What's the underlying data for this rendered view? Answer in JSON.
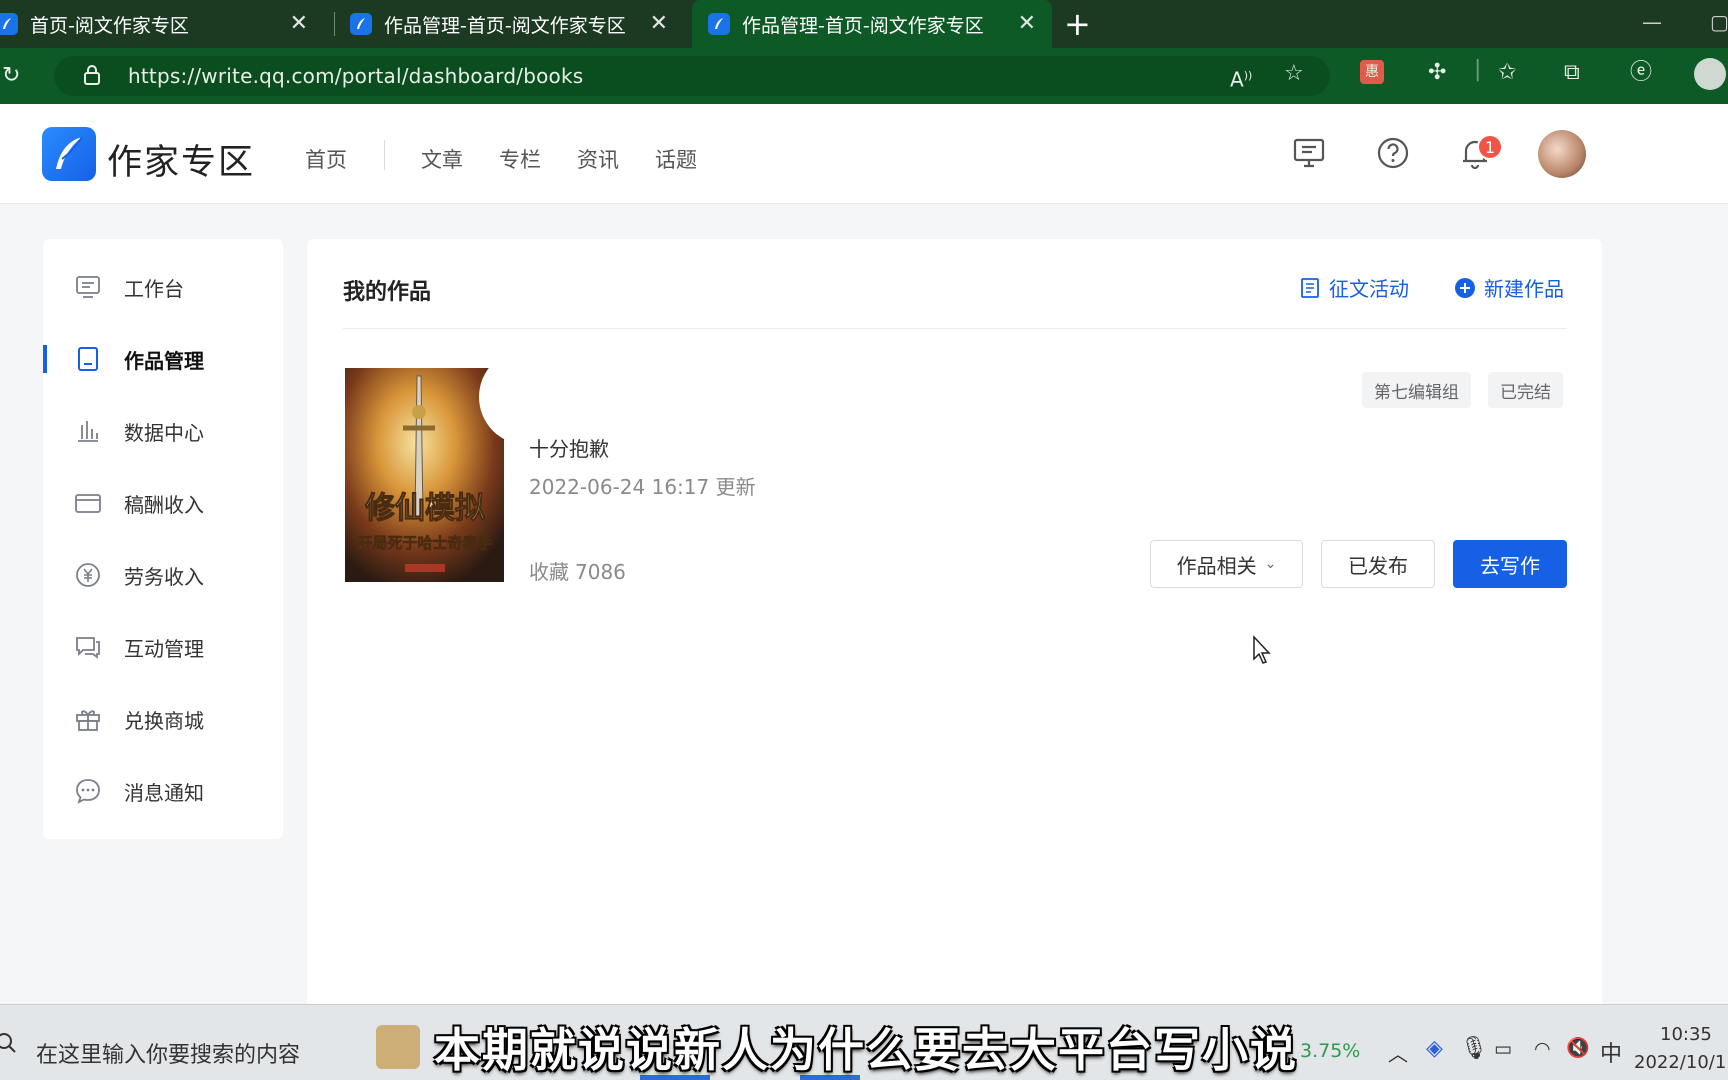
{
  "browser": {
    "tabs": [
      {
        "title": "首页-阅文作家专区",
        "active": false
      },
      {
        "title": "作品管理-首页-阅文作家专区",
        "active": false
      },
      {
        "title": "作品管理-首页-阅文作家专区",
        "active": true
      }
    ],
    "url": "https://write.qq.com/portal/dashboard/books"
  },
  "header": {
    "logo_text": "作家专区",
    "nav": [
      "首页",
      "文章",
      "专栏",
      "资讯",
      "话题"
    ],
    "notification_count": "1"
  },
  "sidebar": {
    "items": [
      {
        "label": "工作台",
        "icon": "desktop-icon"
      },
      {
        "label": "作品管理",
        "icon": "book-icon",
        "active": true
      },
      {
        "label": "数据中心",
        "icon": "bar-chart-icon"
      },
      {
        "label": "稿酬收入",
        "icon": "card-icon"
      },
      {
        "label": "劳务收入",
        "icon": "yuan-icon"
      },
      {
        "label": "互动管理",
        "icon": "chat-icon"
      },
      {
        "label": "兑换商城",
        "icon": "gift-icon"
      },
      {
        "label": "消息通知",
        "icon": "message-icon"
      }
    ]
  },
  "main": {
    "title": "我的作品",
    "contest_link": "征文活动",
    "new_work_link": "新建作品",
    "book": {
      "cover_title": "修仙模拟",
      "cover_subtitle": "开局死于哈士奇毒手",
      "title_fragment": "十分抱歉",
      "updated": "2022-06-24 16:17 更新",
      "favorites_label": "收藏",
      "favorites_value": "7086",
      "tags": [
        "第七编辑组",
        "已完结"
      ],
      "buttons": {
        "related": "作品相关",
        "published": "已发布",
        "write": "去写作"
      }
    }
  },
  "taskbar": {
    "search_placeholder": "在这里输入你要搜索的内容",
    "stock_fragment": "3.75%",
    "ime": "中",
    "time": "10:35",
    "date": "2022/10/1"
  },
  "subtitle": "本期就说说新人为什么要去大平台写小说",
  "colors": {
    "brand": "#1660e6",
    "browser_chrome": "#0e5a26",
    "badge": "#f25346"
  }
}
